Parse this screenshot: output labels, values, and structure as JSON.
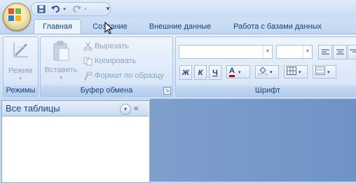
{
  "tabs": [
    {
      "label": "Главная",
      "active": true
    },
    {
      "label": "Создание",
      "active": false
    },
    {
      "label": "Внешние данные",
      "active": false
    },
    {
      "label": "Работа с базами данных",
      "active": false
    }
  ],
  "ribbon": {
    "groups": {
      "modes": {
        "label": "Режимы",
        "view_button": "Режим"
      },
      "clipboard": {
        "label": "Буфер обмена",
        "paste": "Вставить",
        "cut": "Вырезать",
        "copy": "Копировать",
        "format_painter": "Формат по образцу"
      },
      "font": {
        "label": "Шрифт",
        "font_name": "",
        "font_size": "",
        "bold": "Ж",
        "italic": "К",
        "underline": "Ч",
        "font_color": "A"
      }
    }
  },
  "nav_pane": {
    "title": "Все таблицы",
    "menu_glyph": "▾",
    "collapse_glyph": "«"
  },
  "colors": {
    "accent": "#15428b",
    "workspace": "#7393c5",
    "ribbon_bg": "#dbe8f8"
  }
}
